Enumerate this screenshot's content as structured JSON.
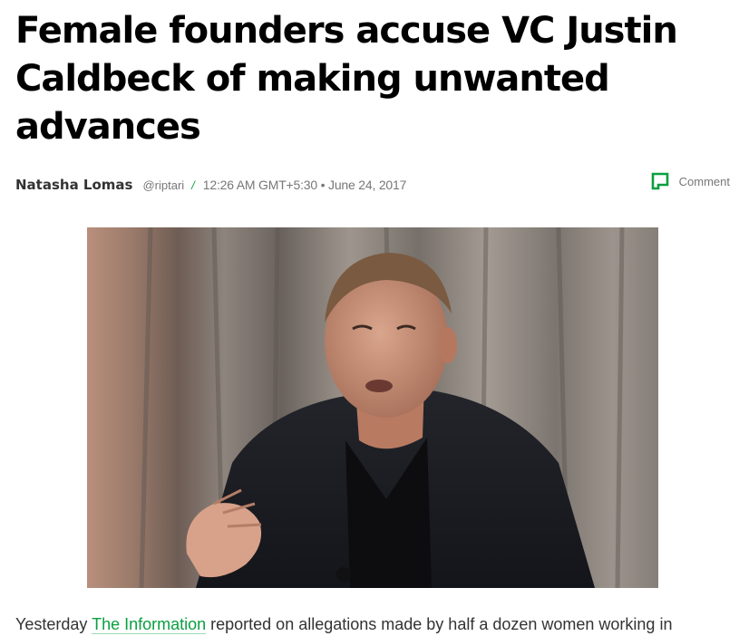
{
  "article": {
    "headline": "Female founders accuse VC Justin Caldbeck of making unwanted advances",
    "author": "Natasha Lomas",
    "handle": "@riptari",
    "separator": "/",
    "dateline": "12:26 AM GMT+5:30 • June 24, 2017",
    "comment_label": "Comment",
    "body": {
      "prefix": "Yesterday ",
      "link_text": "The Information",
      "suffix": " reported on allegations made by half a dozen women working in"
    }
  },
  "icons": {
    "comment": "comment-icon"
  },
  "colors": {
    "accent": "#0a9f3f",
    "headline": "#000000",
    "meta": "#777777",
    "body": "#333333"
  }
}
